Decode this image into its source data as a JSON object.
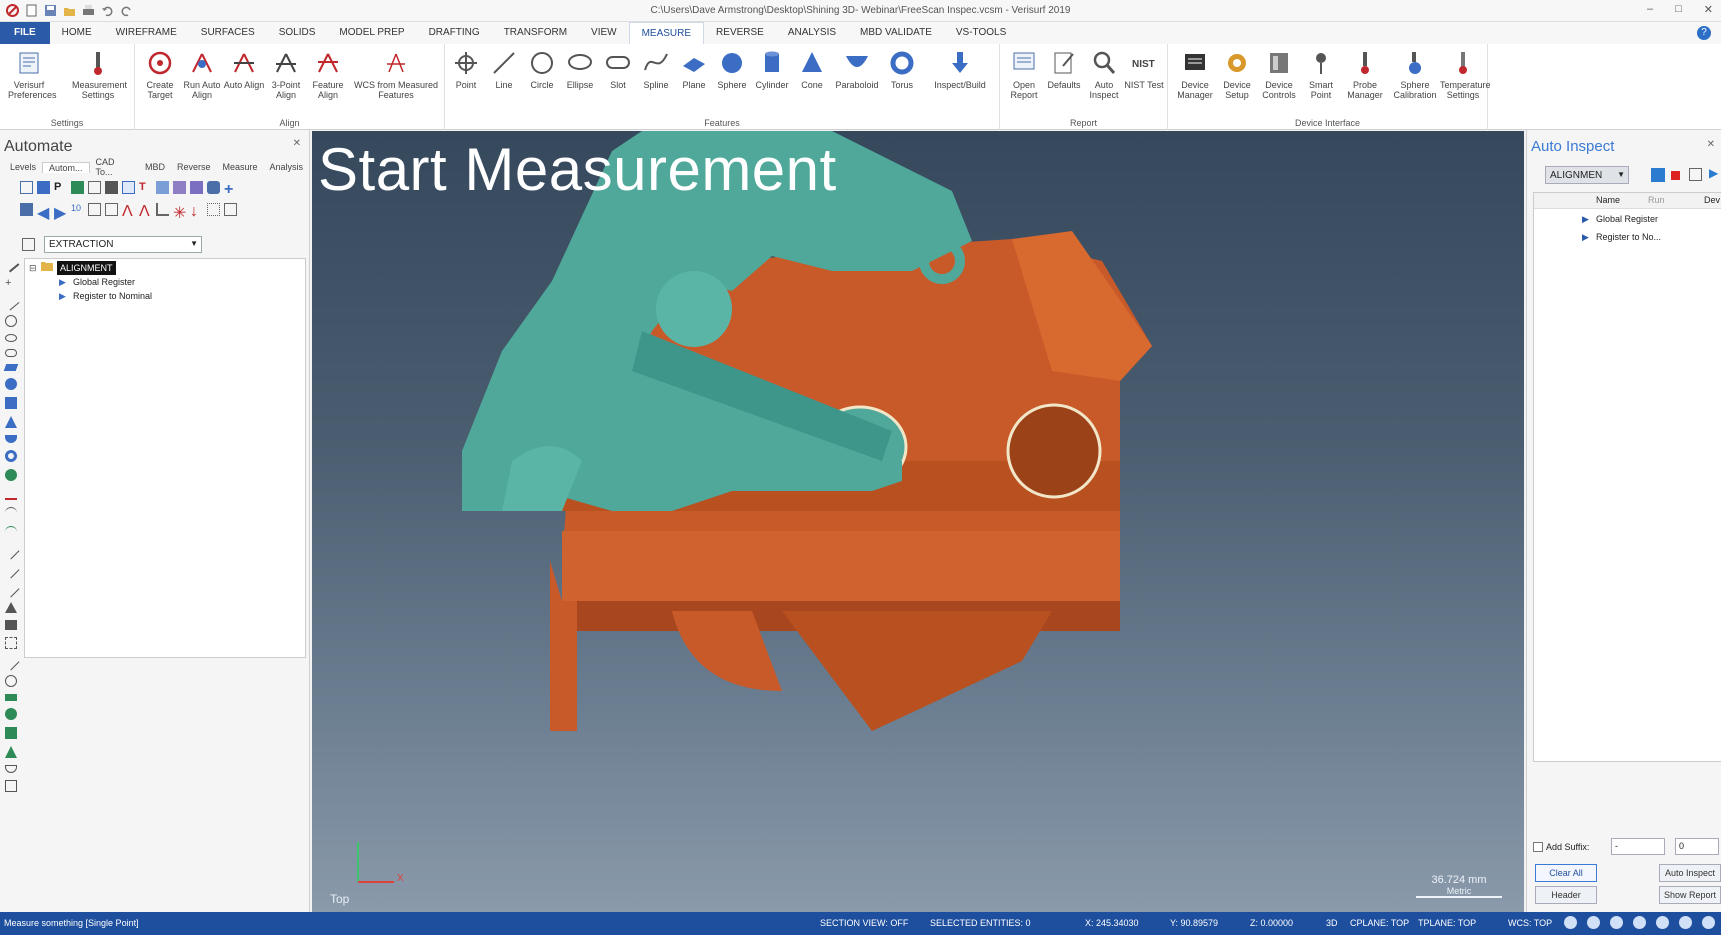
{
  "window": {
    "title": "C:\\Users\\Dave Armstrong\\Desktop\\Shining 3D- Webinar\\FreeScan Inspec.vcsm - Verisurf 2019"
  },
  "menu": {
    "tabs": [
      "FILE",
      "HOME",
      "WIREFRAME",
      "SURFACES",
      "SOLIDS",
      "MODEL PREP",
      "DRAFTING",
      "TRANSFORM",
      "VIEW",
      "MEASURE",
      "REVERSE",
      "ANALYSIS",
      "MBD VALIDATE",
      "VS-TOOLS"
    ],
    "active": "MEASURE"
  },
  "ribbon": {
    "settings": {
      "label": "Settings",
      "buttons": [
        "Verisurf Preferences",
        "Measurement Settings"
      ]
    },
    "align": {
      "label": "Align",
      "buttons": [
        "Create Target",
        "Run Auto Align",
        "Auto Align",
        "3-Point Align",
        "Feature Align",
        "WCS from Measured Features"
      ]
    },
    "features": {
      "label": "Features",
      "buttons": [
        "Point",
        "Line",
        "Circle",
        "Ellipse",
        "Slot",
        "Spline",
        "Plane",
        "Sphere",
        "Cylinder",
        "Cone",
        "Paraboloid",
        "Torus",
        "Inspect/Build"
      ]
    },
    "report": {
      "label": "Report",
      "buttons": [
        "Open Report",
        "Defaults",
        "Auto Inspect",
        "NIST Test"
      ]
    },
    "device": {
      "label": "Device Interface",
      "buttons": [
        "Device Manager",
        "Device Setup",
        "Device Controls",
        "Smart Point",
        "Probe Manager",
        "Sphere Calibration",
        "Temperature Settings"
      ]
    }
  },
  "left_panel": {
    "title": "Automate",
    "tabs": [
      "Levels",
      "Autom...",
      "CAD To...",
      "MBD",
      "Reverse",
      "Measure",
      "Analysis"
    ],
    "active_tab": "Autom...",
    "dropdown_value": "EXTRACTION",
    "tree": {
      "root": "ALIGNMENT",
      "children": [
        "Global Register",
        "Register to Nominal"
      ]
    }
  },
  "viewport": {
    "overlay_title": "Start Measurement",
    "view_name": "Top",
    "scale_value": "36.724 mm",
    "scale_unit": "Metric",
    "axis_x": "X"
  },
  "right_panel": {
    "title": "Auto Inspect",
    "dropdown_value": "ALIGNMEN",
    "columns": [
      "Name",
      "Run",
      "Dev"
    ],
    "rows": [
      "Global Register",
      "Register to No..."
    ],
    "add_suffix_label": "Add Suffix:",
    "suffix_value": "-",
    "suffix_number": "0",
    "buttons": {
      "clear_all": "Clear All",
      "auto_inspect": "Auto Inspect",
      "header": "Header",
      "show_report": "Show Report"
    }
  },
  "status": {
    "message": "Measure something [Single Point]",
    "section_view": "SECTION VIEW: OFF",
    "selected": "SELECTED ENTITIES: 0",
    "x": "X:  245.34030",
    "y": "Y:  90.89579",
    "z": "Z:  0.00000",
    "mode": "3D",
    "cplane": "CPLANE: TOP",
    "tplane": "TPLANE: TOP",
    "wcs": "WCS: TOP"
  },
  "colors": {
    "accent": "#2b5aa8",
    "part": "#c85a2a",
    "scan": "#4fa89a",
    "status_bar": "#1e4f9e"
  }
}
